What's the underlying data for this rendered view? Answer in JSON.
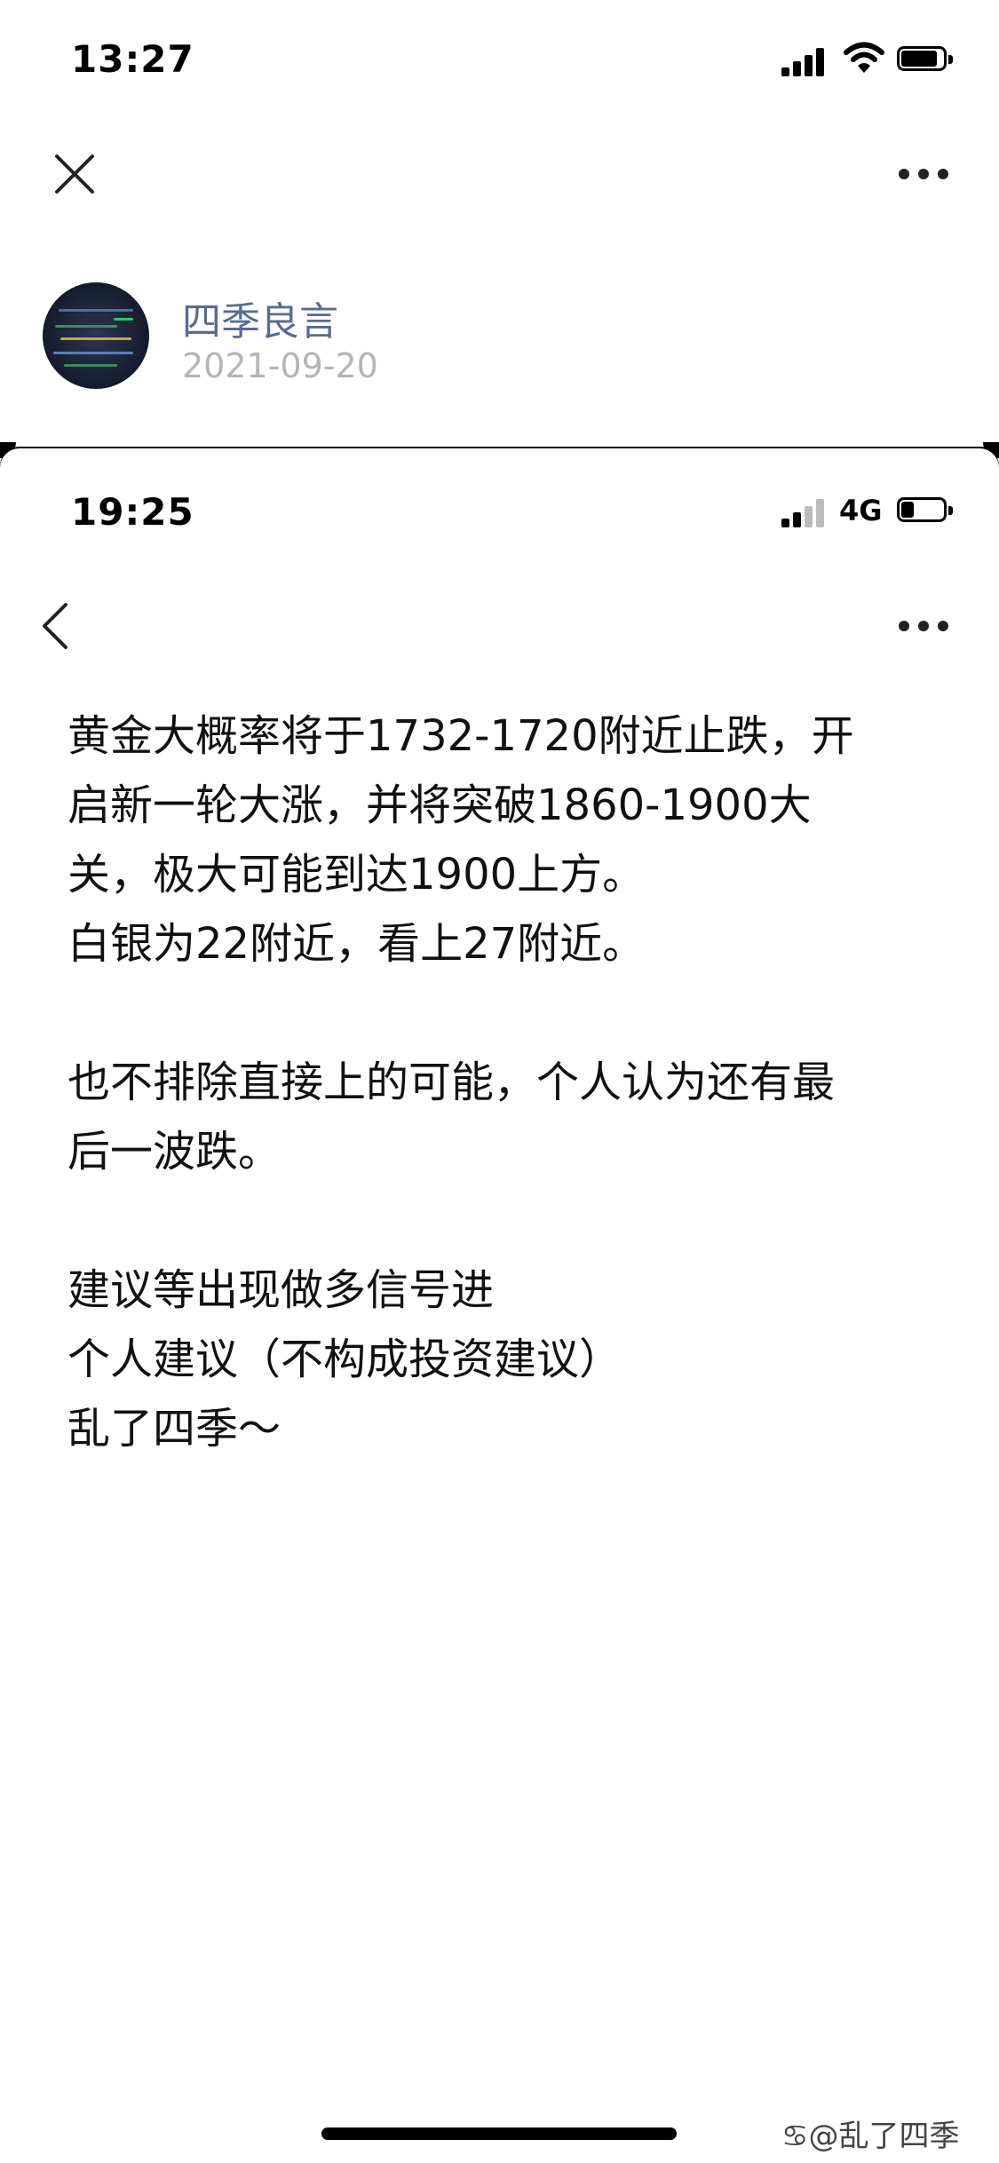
{
  "status_bar": {
    "time": "13:27"
  },
  "author": {
    "name": "四季良言",
    "date": "2021-09-20"
  },
  "inner_screenshot": {
    "status_time": "19:25",
    "network": "4G",
    "lines": [
      "黄金大概率将于1732-1720附近止跌，开",
      "启新一轮大涨，并将突破1860-1900大",
      "关，极大可能到达1900上方。",
      "白银为22附近，看上27附近。",
      "",
      "也不排除直接上的可能，个人认为还有最",
      "后一波跌。",
      "",
      "建议等出现做多信号进",
      "个人建议（不构成投资建议）",
      "乱了四季～"
    ]
  },
  "watermark": "@乱了四季",
  "colors": {
    "author_name": "#576b95",
    "date": "#b5b5b5",
    "text": "#111111"
  }
}
